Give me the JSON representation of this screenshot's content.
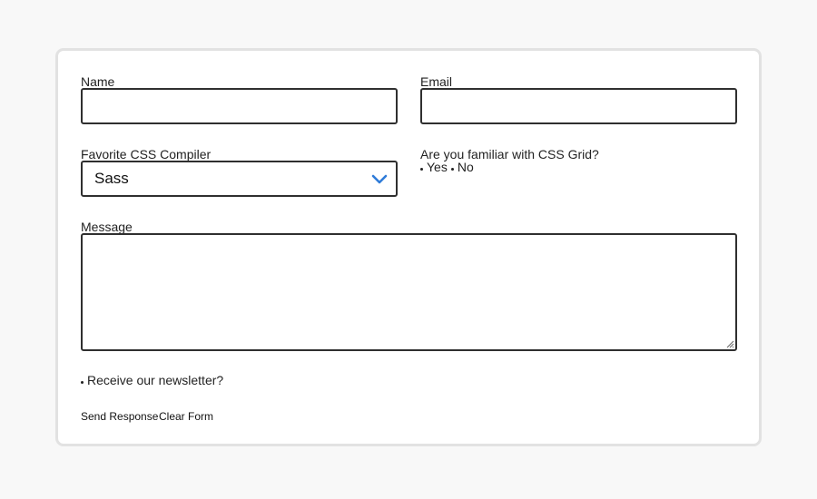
{
  "form": {
    "name_label": "Name",
    "name_value": "",
    "email_label": "Email",
    "email_value": "",
    "compiler_label": "Favorite CSS Compiler",
    "compiler_selected": "Sass",
    "grid_question": "Are you familiar with CSS Grid?",
    "grid_options": [
      "Yes",
      "No"
    ],
    "message_label": "Message",
    "message_value": "",
    "newsletter_label": "Receive our newsletter?",
    "send_label": "Send Response",
    "clear_label": "Clear Form"
  },
  "colors": {
    "background": "#f8f8f8",
    "card": "#ffffff",
    "card_border": "#e2e2e2",
    "field_border": "#2f2f2f",
    "accent": "#2f7bd8"
  },
  "icons": {
    "select_arrow": "chevron-down-icon",
    "textarea_resize": "resize-handle-icon",
    "option_marker": "bullet-dot-icon"
  }
}
